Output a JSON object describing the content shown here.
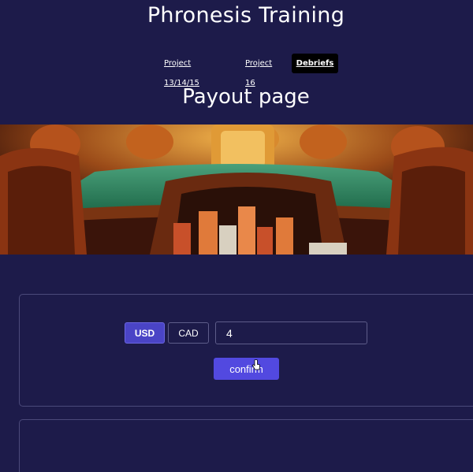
{
  "header": {
    "title": "Phronesis Training",
    "nav": [
      {
        "label": "Project 13/14/15",
        "active": false
      },
      {
        "label": "Project 16",
        "active": false
      },
      {
        "label": "Debriefs",
        "active": true
      }
    ],
    "page_heading": "Payout page"
  },
  "hero": {
    "subject": "casino-table-chips-image"
  },
  "payout_form": {
    "currencies": [
      {
        "label": "USD",
        "selected": true
      },
      {
        "label": "CAD",
        "selected": false
      }
    ],
    "amount_value": "4",
    "confirm_label": "confirm"
  },
  "colors": {
    "background": "#1d1b4a",
    "accent": "#5249e0",
    "active_nav": "#000000"
  }
}
